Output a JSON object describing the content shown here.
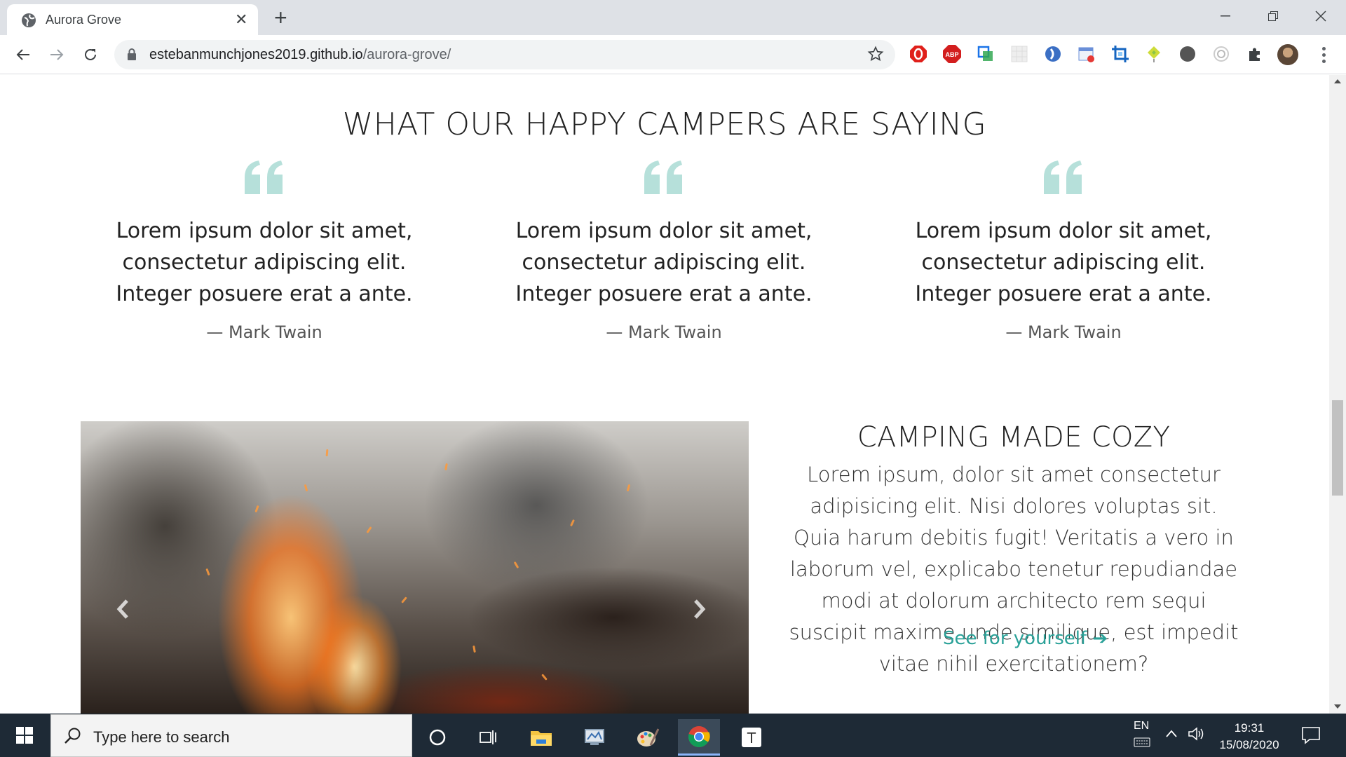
{
  "browser": {
    "tab_title": "Aurora Grove",
    "url_host": "estebanmunchjones2019.github.io",
    "url_path": "/aurora-grove/"
  },
  "page": {
    "testimonials_title": "WHAT OUR HAPPY CAMPERS ARE SAYING",
    "testimonials": [
      {
        "text": "Lorem ipsum dolor sit amet, consectetur adipiscing elit. Integer posuere erat a ante.",
        "author": "— Mark Twain"
      },
      {
        "text": "Lorem ipsum dolor sit amet, consectetur adipiscing elit. Integer posuere erat a ante.",
        "author": "— Mark Twain"
      },
      {
        "text": "Lorem ipsum dolor sit amet, consectetur adipiscing elit. Integer posuere erat a ante.",
        "author": "— Mark Twain"
      }
    ],
    "cozy_title": "CAMPING MADE COZY",
    "cozy_body": "Lorem ipsum, dolor sit amet consectetur adipisicing elit. Nisi dolores voluptas sit. Quia harum debitis fugit! Veritatis a vero in laborum vel, explicabo tenetur repudiandae modi at dolorum architecto rem sequi suscipit maxime unde similique, est impedit vitae nihil exercitationem?",
    "cozy_link": "See for yourself",
    "accent_color": "#2aa198",
    "quote_color": "#b6e0da"
  },
  "taskbar": {
    "search_placeholder": "Type here to search",
    "lang": "EN",
    "time": "19:31",
    "date": "15/08/2020"
  }
}
